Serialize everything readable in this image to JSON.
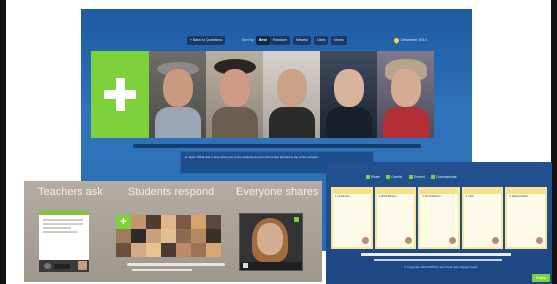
{
  "main": {
    "topbar": {
      "back_button": "« Back to Questions",
      "sort_label": "Sort by:",
      "sort_options": [
        "Best",
        "Random",
        "Newest",
        "Likes",
        "Views"
      ],
      "location": "December 2013"
    },
    "caption": "A. Topic: What was a time when you or the students at your school first learned to the of the school?..."
  },
  "teachers_panel": {
    "headings": [
      "Teachers ask",
      "Students respond",
      "Everyone shares"
    ],
    "add_symbol": "+"
  },
  "board": {
    "menu": [
      "Share",
      "Contrib.",
      "Embed",
      "Communicate"
    ],
    "columns": [
      {
        "text": "1. Introduction ..."
      },
      {
        "text": "2. WOW Moment ..."
      },
      {
        "text": "3. Lift Off Moment ..."
      },
      {
        "text": "4. Topic ..."
      },
      {
        "text": "5. Final Questions ..."
      }
    ],
    "copyright": "© Copyright 2013 MOOCs and Open Ed / Flipgrid Team",
    "reply_button": "Reply"
  },
  "colors": {
    "main_bg": "#2a6cb2",
    "accent_green": "#7dd13a",
    "board_bg": "#23508f",
    "panel_bg": "#b0a9a0"
  }
}
